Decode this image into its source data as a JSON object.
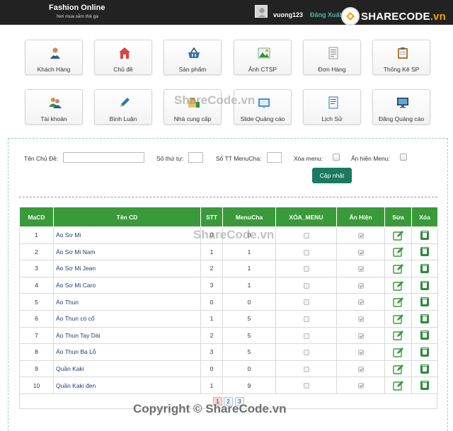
{
  "header": {
    "brand": "Fashion Online",
    "slogan": "Nơi mua sắm thả ga",
    "username": "vuong123",
    "logout_label": "Đăng Xuất",
    "logo_text_main": "SHARECODE",
    "logo_text_suffix": ".vn"
  },
  "menu": [
    {
      "label": "Khách Hàng",
      "icon": "customer-icon"
    },
    {
      "label": "Chủ đề",
      "icon": "home-icon"
    },
    {
      "label": "Sản phẩm",
      "icon": "basket-icon"
    },
    {
      "label": "Ảnh CTSP",
      "icon": "image-icon"
    },
    {
      "label": "Đơn Hàng",
      "icon": "document-icon"
    },
    {
      "label": "Thống Kê SP",
      "icon": "clipboard-icon"
    },
    {
      "label": "Tài khoản",
      "icon": "users-icon"
    },
    {
      "label": "Bình Luận",
      "icon": "pencil-icon"
    },
    {
      "label": "Nhà cung cấp",
      "icon": "supplier-icon"
    },
    {
      "label": "Slide Quảng cáo",
      "icon": "slide-icon"
    },
    {
      "label": "Lịch Sử",
      "icon": "history-icon"
    },
    {
      "label": "Đăng Quảng cáo",
      "icon": "monitor-icon"
    }
  ],
  "form": {
    "name_label": "Tên Chủ Đề:",
    "name_value": "",
    "order_label": "Số thứ tự:",
    "order_value": "",
    "parent_label": "Số TT MenuCha:",
    "parent_value": "",
    "delete_label": "Xóa menu:",
    "show_label": "Ẩn hiện Menu:",
    "submit_label": "Cập nhật"
  },
  "table": {
    "columns": [
      "MaCD",
      "Tên CD",
      "STT",
      "MenuCha",
      "XÓA_MENU",
      "Ẩn Hiện",
      "Sửa",
      "Xóa"
    ],
    "rows": [
      {
        "id": "1",
        "name": "Áo Sơ Mi",
        "stt": "0",
        "parent": "0",
        "deleted": false,
        "shown": true
      },
      {
        "id": "2",
        "name": "Áo Sơ Mi Nam",
        "stt": "1",
        "parent": "1",
        "deleted": false,
        "shown": true
      },
      {
        "id": "3",
        "name": "Áo Sơ Mi Jean",
        "stt": "2",
        "parent": "1",
        "deleted": false,
        "shown": true
      },
      {
        "id": "4",
        "name": "Áo Sơ Mi Caro",
        "stt": "3",
        "parent": "1",
        "deleted": false,
        "shown": true
      },
      {
        "id": "5",
        "name": "Áo Thun",
        "stt": "0",
        "parent": "0",
        "deleted": false,
        "shown": true
      },
      {
        "id": "6",
        "name": "Áo Thun có cổ",
        "stt": "1",
        "parent": "5",
        "deleted": false,
        "shown": true
      },
      {
        "id": "7",
        "name": "Áo Thun Tay Dài",
        "stt": "2",
        "parent": "5",
        "deleted": false,
        "shown": true
      },
      {
        "id": "8",
        "name": "Áo Thun Ba Lỗ",
        "stt": "3",
        "parent": "5",
        "deleted": false,
        "shown": true
      },
      {
        "id": "9",
        "name": "Quần Kaki",
        "stt": "0",
        "parent": "0",
        "deleted": false,
        "shown": true
      },
      {
        "id": "10",
        "name": "Quần Kaki đen",
        "stt": "1",
        "parent": "9",
        "deleted": false,
        "shown": true
      }
    ]
  },
  "pagination": {
    "pages": [
      "1",
      "2",
      "3"
    ],
    "current": "1"
  },
  "watermarks": [
    "ShareCode.vn",
    "ShareCode.vn"
  ],
  "copyright": "Copyright © ShareCode.vn",
  "colors": {
    "header_bg": "#222222",
    "table_header": "#3a9a3a",
    "button": "#1a7a60",
    "link": "#1f3f7a"
  }
}
